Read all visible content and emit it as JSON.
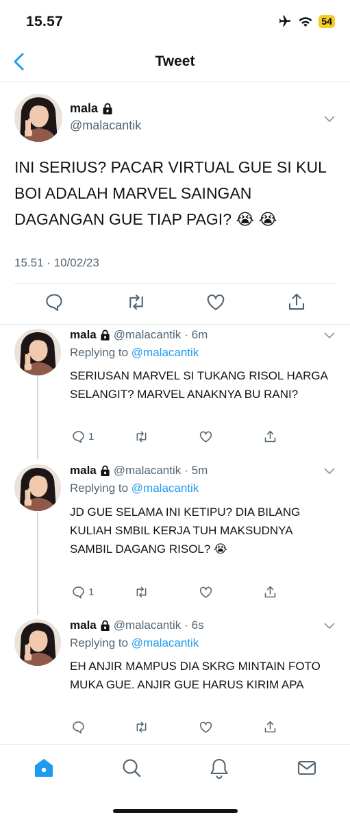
{
  "status_bar": {
    "time": "15.57",
    "battery": "54",
    "icons": [
      "airplane-icon",
      "wifi-icon",
      "battery-icon"
    ]
  },
  "nav": {
    "title": "Tweet",
    "back_icon": "chevron-left-icon"
  },
  "main_tweet": {
    "name": "mala",
    "handle": "@malacantik",
    "lock_icon": "lock-icon",
    "text": "INI SERIUS? PACAR VIRTUAL GUE SI KUL BOI ADALAH MARVEL SAINGAN DAGANGAN GUE TIAP PAGI? 😭 😭",
    "timestamp": "15.51 · 10/02/23",
    "actions": [
      "reply-icon",
      "retweet-icon",
      "like-icon",
      "share-icon"
    ]
  },
  "replies": [
    {
      "name": "mala",
      "handle": "@malacantik",
      "time": "· 6m",
      "replying_prefix": "Replying to",
      "replying_to": "@malacantik",
      "text": "SERIUSAN MARVEL SI TUKANG RISOL HARGA SELANGIT? MARVEL ANAKNYA BU RANI?",
      "reply_count": "1"
    },
    {
      "name": "mala",
      "handle": "@malacantik",
      "time": "· 5m",
      "replying_prefix": "Replying to",
      "replying_to": "@malacantik",
      "text": "JD GUE SELAMA INI KETIPU? DIA BILANG KULIAH SMBIL KERJA TUH MAKSUDNYA SAMBIL DAGANG RISOL? 😭",
      "reply_count": "1"
    },
    {
      "name": "mala",
      "handle": "@malacantik",
      "time": "· 6s",
      "replying_prefix": "Replying to",
      "replying_to": "@malacantik",
      "text": "EH ANJIR MAMPUS DIA SKRG MINTAIN FOTO MUKA GUE. ANJIR GUE HARUS KIRIM APA",
      "reply_count": ""
    }
  ],
  "tabbar": {
    "tabs": [
      "home-icon",
      "search-icon",
      "notifications-icon",
      "messages-icon"
    ],
    "active_tab": "home-icon"
  },
  "colors": {
    "accent": "#1d9bf0",
    "text": "#0f1419",
    "secondary": "#536471",
    "divider": "#e3e6e8",
    "battery": "#f4cc2c"
  }
}
